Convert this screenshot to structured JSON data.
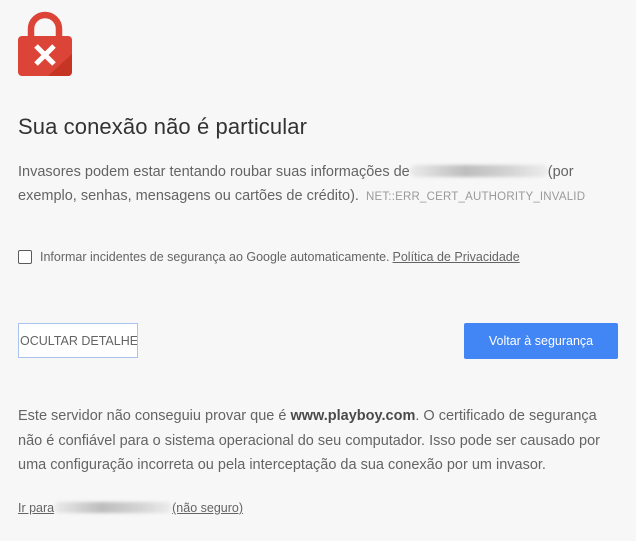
{
  "interstitial": {
    "heading": "Sua conexão não é particular",
    "intro_before": "Invasores podem estar tentando roubar suas informações de",
    "intro_after": "(por exemplo, senhas, mensagens ou cartões de crédito).",
    "error_code": "NET::ERR_CERT_AUTHORITY_INVALID",
    "optin_text": "Informar incidentes de segurança ao Google automaticamente.",
    "privacy_link": "Política de Privacidade",
    "details_button": "OCULTAR DETALHES",
    "primary_button": "Voltar à segurança",
    "details_before": "Este servidor não conseguiu provar que é ",
    "details_domain": "www.playboy.com",
    "details_after": ". O certificado de segurança não é confiável para o sistema operacional do seu computador. Isso pode ser causado por uma configuração incorreta ou pela interceptação da sua conexão por um invasor.",
    "proceed_before": "Ir para",
    "proceed_after": "(não seguro)"
  },
  "colors": {
    "lock_red": "#db4437",
    "lock_dark_red": "#a52714",
    "primary_blue": "#4285f4",
    "background": "#f7f7f7"
  },
  "icons": {
    "lock": "red-lock-icon"
  }
}
